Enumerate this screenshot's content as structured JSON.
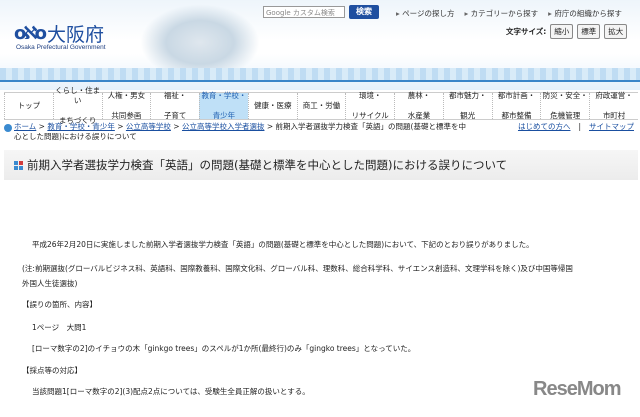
{
  "header": {
    "logo_name": "大阪府",
    "logo_en": "Osaka Prefectural Government",
    "search_placeholder": "Google カスタム検索",
    "search_button": "検索",
    "top_links": [
      "ページの探し方",
      "カテゴリーから探す",
      "府庁の組織から探す"
    ],
    "font_size_label": "文字サイズ:",
    "font_sizes": [
      "縮小",
      "標準",
      "拡大"
    ]
  },
  "nav": [
    {
      "l1": "トップ",
      "l2": ""
    },
    {
      "l1": "くらし・住まい",
      "l2": "まちづくり"
    },
    {
      "l1": "人権・男女",
      "l2": "共同参画"
    },
    {
      "l1": "福祉・",
      "l2": "子育て"
    },
    {
      "l1": "教育・学校・",
      "l2": "青少年"
    },
    {
      "l1": "健康・医療",
      "l2": ""
    },
    {
      "l1": "商工・労働",
      "l2": ""
    },
    {
      "l1": "環境・",
      "l2": "リサイクル"
    },
    {
      "l1": "農林・",
      "l2": "水産業"
    },
    {
      "l1": "都市魅力・",
      "l2": "観光"
    },
    {
      "l1": "都市計画・",
      "l2": "都市整備"
    },
    {
      "l1": "防災・安全・",
      "l2": "危機管理"
    },
    {
      "l1": "府政運営・",
      "l2": "市町村"
    }
  ],
  "breadcrumb": {
    "items": [
      "ホーム",
      "教育・学校・青少年",
      "公立高等学校",
      "公立高等学校入学者選抜"
    ],
    "current_1": "前期入学者選抜学力検査「英語」の問題(基礎と標準を中",
    "current_2": "心とした問題)における誤りについて",
    "sep": " > ",
    "first_visit": "はじめての方へ",
    "sitemap": "サイトマップ"
  },
  "title": "前期入学者選抜学力検査「英語」の問題(基礎と標準を中心とした問題)における誤りについて",
  "content": {
    "p1": "平成26年2月20日に実施しました前期入学者選抜学力検査「英語」の問題(基礎と標準を中心とした問題)において、下記のとおり誤りがありました。",
    "note1": "(注:前期選抜(グローバルビジネス科、英語科、国際教養科、国際文化科、グローバル科、理数科、総合科学科、サイエンス創造科、文理学科を除く)及び中国等帰国",
    "note2": "外国人生徒選抜)",
    "h1": "【誤りの箇所、内容】",
    "loc": "1ページ　大問1",
    "detail": "[ローマ数字の2]のイチョウの木「ginkgo trees」のスペルが1か所(最終行)のみ「gingko trees」となっていた。",
    "h2": "【採点等の対応】",
    "resp": "当該問題1[ローマ数字の2](3)配点2点については、受験生全員正解の扱いとする。"
  },
  "watermark": "ReseMom"
}
